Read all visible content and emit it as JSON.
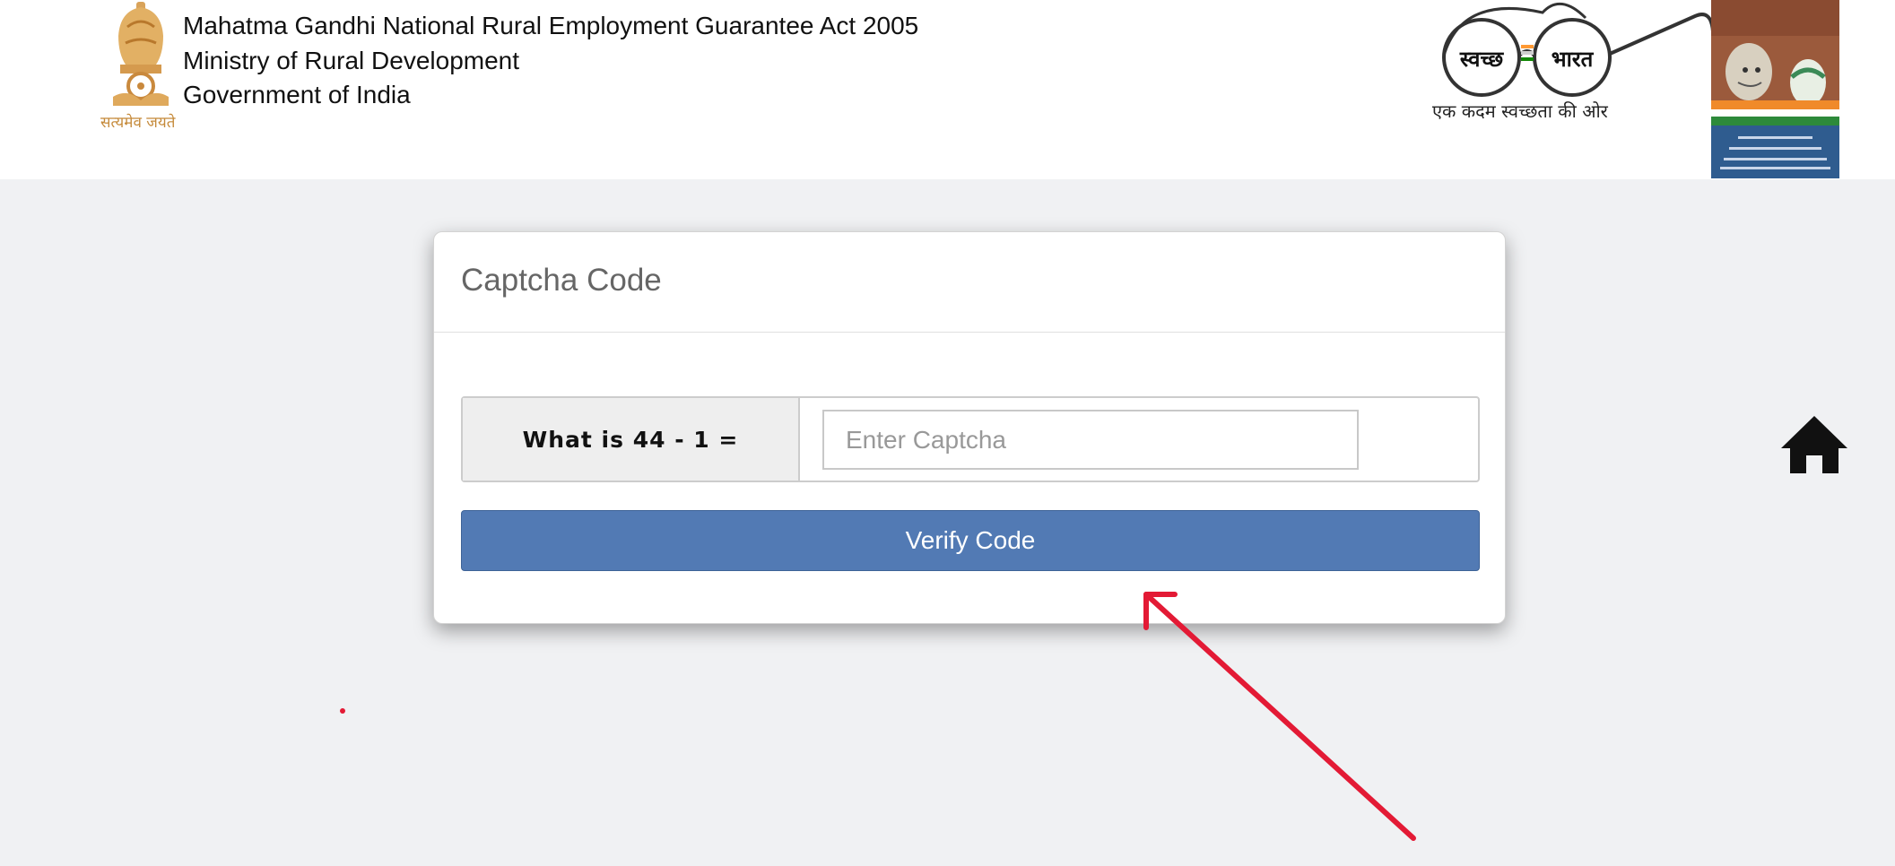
{
  "header": {
    "ministry_lines": [
      "Mahatma Gandhi National Rural Employment Guarantee Act 2005",
      "Ministry of Rural Development",
      "Government of India"
    ],
    "emblem_motto": "सत्यमेव जयते",
    "swachh_bharat": {
      "word_left": "स्वच्छ",
      "word_right": "भारत",
      "tagline": "एक कदम स्वच्छता की ओर"
    },
    "mgnrega_badge_icon": "mgnrega-gandhi-badge"
  },
  "captcha_card": {
    "title": "Captcha Code",
    "question": "What is 44 - 1 =",
    "input_placeholder": "Enter Captcha",
    "input_value": "",
    "verify_label": "Verify Code"
  },
  "nav": {
    "home_icon": "home-icon"
  },
  "annotation": {
    "arrow_color": "#e31a35"
  },
  "colors": {
    "page_background": "#f0f1f3",
    "button": "#527ab4",
    "title_text": "#666666"
  }
}
